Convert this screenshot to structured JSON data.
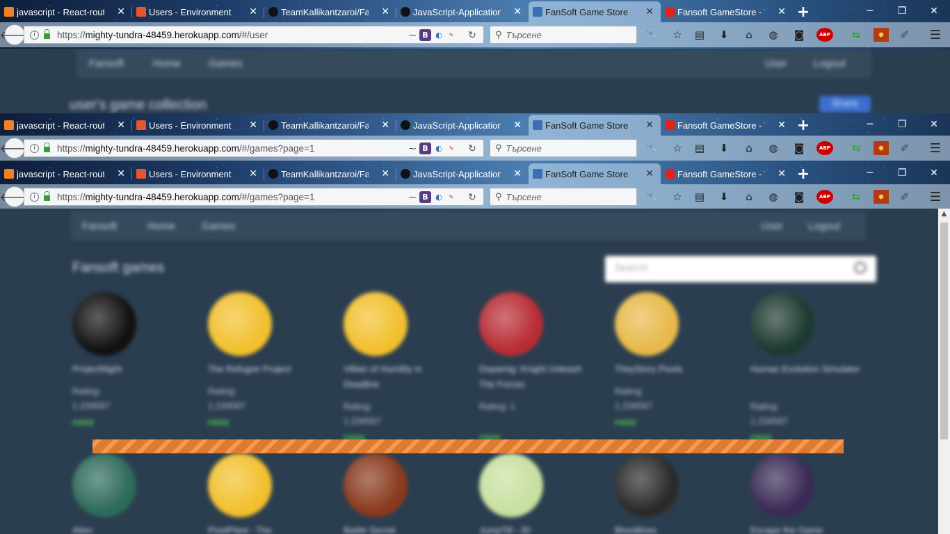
{
  "browser": {
    "tabs": [
      {
        "label": "javascript - React-router",
        "favicon_color": "#f48024"
      },
      {
        "label": "Users - Environment",
        "favicon_color": "#e8542c"
      },
      {
        "label": "TeamKallikantzaroi/Fans",
        "favicon_color": "#111111"
      },
      {
        "label": "JavaScript-Applications/",
        "favicon_color": "#111111"
      },
      {
        "label": "FanSoft Game Store",
        "favicon_color": "#3b6fb6",
        "active": true
      },
      {
        "label": "Fansoft GameStore - You",
        "favicon_color": "#e62117"
      }
    ],
    "windows": [
      {
        "url_prefix": "https://",
        "url_host": "mighty-tundra-48459.herokuapp.com",
        "url_path": "/#/user"
      },
      {
        "url_prefix": "https://",
        "url_host": "mighty-tundra-48459.herokuapp.com",
        "url_path": "/#/games?page=1"
      },
      {
        "url_prefix": "https://",
        "url_host": "mighty-tundra-48459.herokuapp.com",
        "url_path": "/#/games?page=1"
      }
    ],
    "search_placeholder": "Търсене",
    "extensions": {
      "bootstrap": "B",
      "abp": "ABP"
    }
  },
  "site": {
    "brand": "Fansoft",
    "nav_home": "Home",
    "nav_games": "Games",
    "nav_user": "User",
    "nav_logout": "Logout",
    "user_heading": "user's game collection",
    "user_button": "Share",
    "games_heading": "Fansoft games",
    "search_placeholder": "Search"
  },
  "games": [
    {
      "title": "ProjectNight",
      "rating": "Rating:",
      "rating_value": "1.234567",
      "price": "FREE",
      "color": "#111111"
    },
    {
      "title": "The Refugee Project",
      "rating": "Rating:",
      "rating_value": "1.234567",
      "price": "FREE",
      "color": "#f2c02e"
    },
    {
      "title": "Villain of Humility in Deadline",
      "rating": "Rating:",
      "rating_value": "1.234567",
      "price": "FREE",
      "color": "#f2c02e"
    },
    {
      "title": "Dopamig: Knight Unleash The Forces",
      "rating": "Rating: 1",
      "rating_value": "",
      "price": "FREE",
      "color": "#b82d35"
    },
    {
      "title": "TheyStory Pixels",
      "rating": "Rating:",
      "rating_value": "1.234567",
      "price": "FREE",
      "color": "#e8b94a"
    },
    {
      "title": "Human Evolution Simulator",
      "rating": "Rating:",
      "rating_value": "1.234567",
      "price": "FREE",
      "color": "#1d3a30"
    },
    {
      "title": "Alien",
      "color": "#2e6b5a"
    },
    {
      "title": "PixelPlant - The",
      "color": "#f2c02e"
    },
    {
      "title": "Battle Secret",
      "color": "#8a3a1e"
    },
    {
      "title": "JumpTill - 30",
      "color": "#c8e0a0"
    },
    {
      "title": "Bloodlines",
      "color": "#2a2a2a"
    },
    {
      "title": "Escape the Game",
      "color": "#3a2a55"
    }
  ]
}
